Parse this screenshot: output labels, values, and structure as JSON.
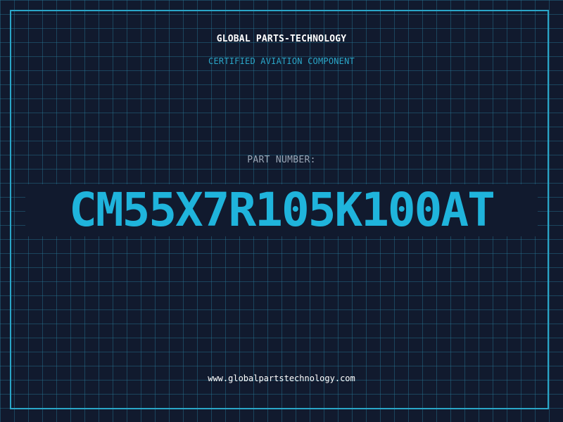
{
  "header": {
    "company_name": "GLOBAL PARTS-TECHNOLOGY",
    "tagline": "CERTIFIED AVIATION COMPONENT"
  },
  "part": {
    "label": "PART NUMBER:",
    "number": "CM55X7R105K100AT"
  },
  "footer": {
    "website": "www.globalpartstechnology.com"
  },
  "colors": {
    "background": "#111a2e",
    "grid": "#28789a",
    "accent": "#1fb4dc",
    "frame": "#2aa6c8",
    "text": "#ffffff",
    "muted": "#9aa6b6"
  }
}
